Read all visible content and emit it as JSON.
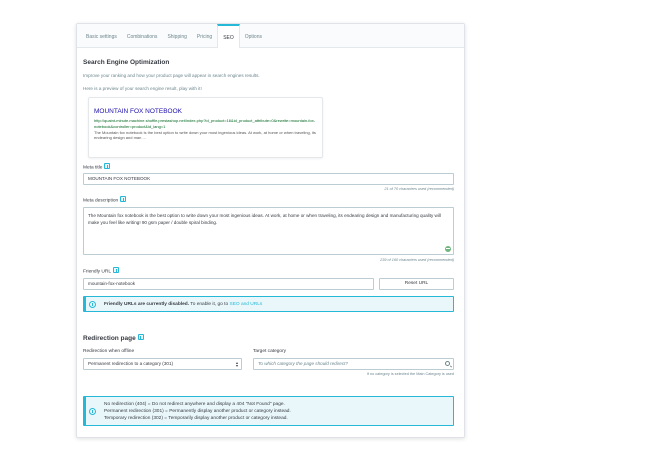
{
  "tabs": [
    {
      "label": "Basic settings"
    },
    {
      "label": "Combinations"
    },
    {
      "label": "Shipping"
    },
    {
      "label": "Pricing"
    },
    {
      "label": "SEO"
    },
    {
      "label": "Options"
    }
  ],
  "seo": {
    "title": "Search Engine Optimization",
    "intro": "Improve your ranking and how your product page will appear in search engines results.",
    "preview_intro": "Here is a preview of your search engine result, play with it!",
    "preview": {
      "title": "MOUNTAIN FOX NOTEBOOK",
      "url": "http://quaint-minute.machine.shuffle.prestashop.net/index.php?id_product=16&id_product_attribute=0&rewrite=mountain-fox-notebook&controller=product&id_lang=1",
      "description": "The Mountain fox notebook is the best option to write down your most ingenious ideas. At work, at home or when traveling, its endearing design and man ..."
    },
    "meta_title_label": "Meta title",
    "meta_title_value": "MOUNTAIN FOX NOTEBOOK",
    "meta_title_count": "21 of 70 characters used (recommended)",
    "meta_description_label": "Meta description",
    "meta_description_value": "The Mountain fox notebook is the best option to write down your most ingenious ideas. At work, at home or when traveling, its endearing design and manufacturing quality will make you feel like writing! 90 gsm paper / double spiral binding.",
    "meta_description_count": "239 of 160 characters used (recommended)",
    "friendly_url_label": "Friendly URL",
    "friendly_url_value": "mountain-fox-notebook",
    "reset_url_label": "Reset URL",
    "alert_bold": "Friendly URLs are currently disabled.",
    "alert_text": " To enable it, go to ",
    "alert_link": "SEO and URLs"
  },
  "redirection": {
    "title": "Redirection page",
    "when_offline_label": "Redirection when offline",
    "when_offline_value": "Permanent redirection to a category (301)",
    "target_label": "Target category",
    "target_placeholder": "To which category the page should redirect?",
    "target_note": "If no category is selected the Main Category is used",
    "info_lines": [
      "No redirection (404) = Do not redirect anywhere and display a 404 \"Not Found\" page.",
      "Permanent redirection (301) = Permanently display another product or category instead.",
      "Temporary redirection (302) = Temporarily display another product or category instead."
    ]
  },
  "colors": {
    "accent": "#25b9d7",
    "success": "#70b580",
    "link_title": "#1a0dab",
    "url_green": "#006621"
  }
}
